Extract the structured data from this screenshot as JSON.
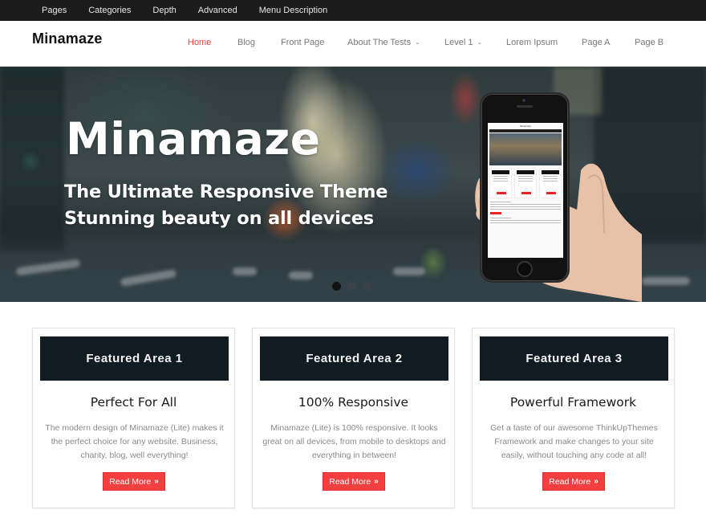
{
  "topbar": {
    "items": [
      "Pages",
      "Categories",
      "Depth",
      "Advanced",
      "Menu Description"
    ]
  },
  "header": {
    "logo": "Minamaze",
    "nav": [
      {
        "label": "Home",
        "active": true,
        "has_dropdown": false
      },
      {
        "label": "Blog",
        "active": false,
        "has_dropdown": false
      },
      {
        "label": "Front Page",
        "active": false,
        "has_dropdown": false
      },
      {
        "label": "About The Tests",
        "active": false,
        "has_dropdown": true
      },
      {
        "label": "Level 1",
        "active": false,
        "has_dropdown": true
      },
      {
        "label": "Lorem Ipsum",
        "active": false,
        "has_dropdown": false
      },
      {
        "label": "Page A",
        "active": false,
        "has_dropdown": false
      },
      {
        "label": "Page B",
        "active": false,
        "has_dropdown": false
      }
    ],
    "dropdown_icon": "chevron-down-icon"
  },
  "hero": {
    "title": "Minamaze",
    "subtitle_line1": "The Ultimate Responsive Theme",
    "subtitle_line2": "Stunning beauty on all devices",
    "slides": 3,
    "active_slide": 1
  },
  "featured": [
    {
      "header": "Featured Area 1",
      "title": "Perfect For All",
      "text": "The modern design of Minamaze (Lite) makes it the perfect choice for any website. Business, charity, blog, well everything!",
      "button": "Read More"
    },
    {
      "header": "Featured Area 2",
      "title": "100% Responsive",
      "text": "Minamaze (Lite) is 100% responsive. It looks great on all devices, from mobile to desktops and everything in between!",
      "button": "Read More"
    },
    {
      "header": "Featured Area 3",
      "title": "Powerful Framework",
      "text": "Get a taste of our awesome ThinkUpThemes Framework and make changes to your site easily, without touching any code at all!",
      "button": "Read More"
    }
  ],
  "button_chevron": "»",
  "colors": {
    "accent": "#f33f3f",
    "topbar_bg": "#1c1c1c",
    "featured_header_bg": "#111b22",
    "body_text": "#8a8a8a"
  }
}
